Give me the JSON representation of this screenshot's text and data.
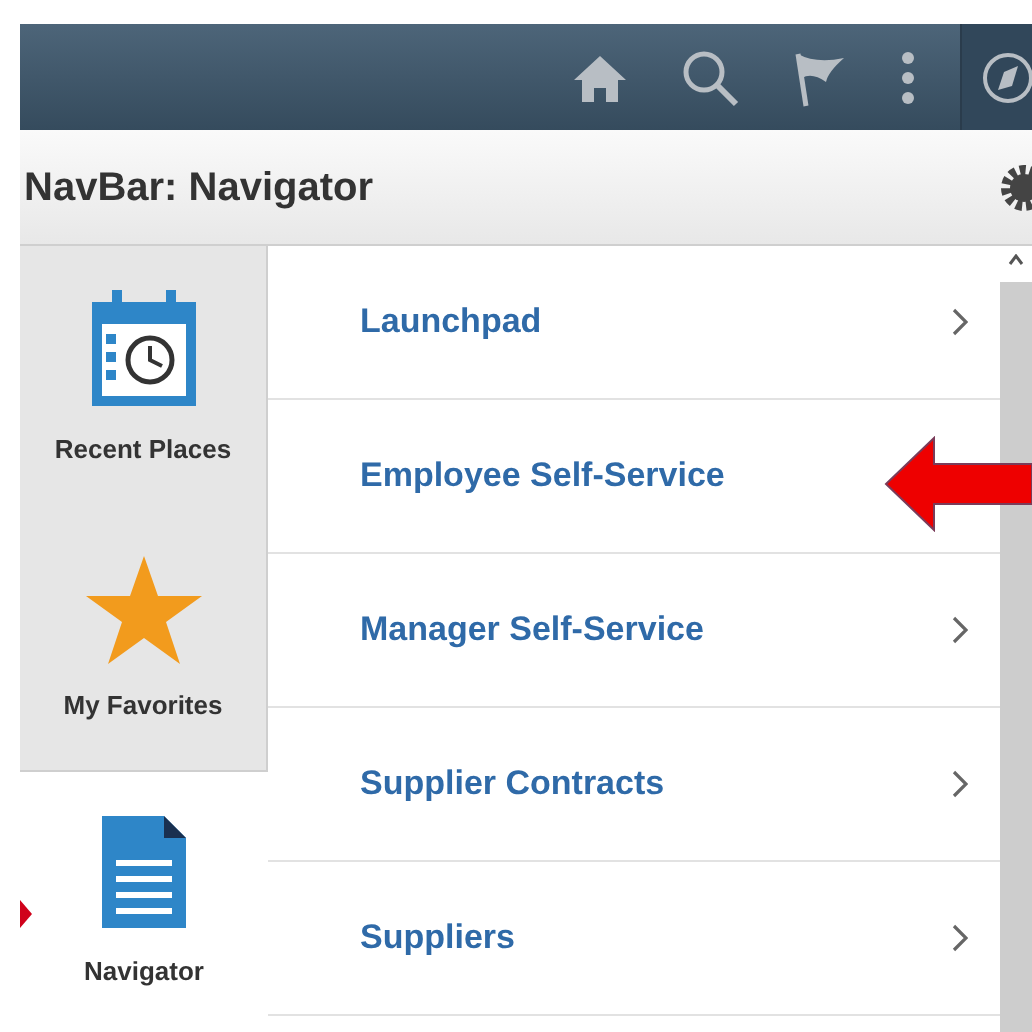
{
  "title": "NavBar: Navigator",
  "sidebar": {
    "items": [
      {
        "label": "Recent Places",
        "kind": "calendar",
        "selected": false,
        "pointer": false
      },
      {
        "label": "My Favorites",
        "kind": "star",
        "selected": false,
        "pointer": false
      },
      {
        "label": "Navigator",
        "kind": "document",
        "selected": true,
        "pointer": true
      }
    ]
  },
  "menu": {
    "items": [
      {
        "label": "Launchpad",
        "chevron": true,
        "pointer": false
      },
      {
        "label": "Employee Self-Service",
        "chevron": false,
        "pointer": true
      },
      {
        "label": "Manager Self-Service",
        "chevron": true,
        "pointer": false
      },
      {
        "label": "Supplier Contracts",
        "chevron": true,
        "pointer": false
      },
      {
        "label": "Suppliers",
        "chevron": true,
        "pointer": false
      }
    ]
  }
}
